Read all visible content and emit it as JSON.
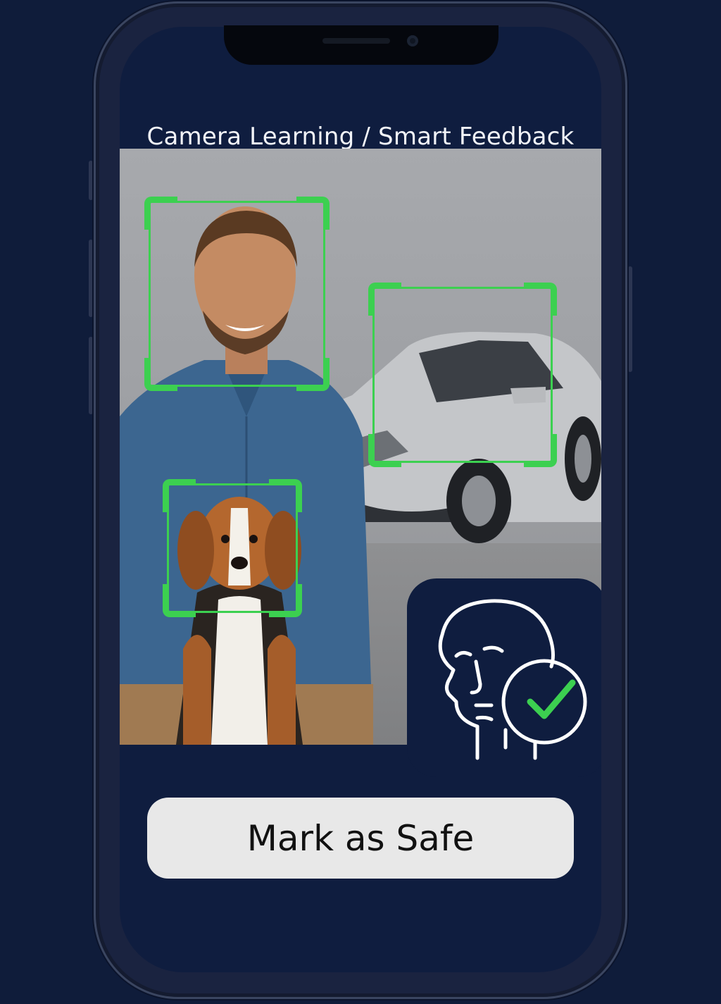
{
  "header": {
    "title": "Camera Learning / Smart Feedback"
  },
  "detections": [
    {
      "object": "person-face"
    },
    {
      "object": "car"
    },
    {
      "object": "dog"
    }
  ],
  "badge": {
    "icon": "face-recognition-check-icon"
  },
  "actions": {
    "mark_safe_label": "Mark as Safe"
  },
  "colors": {
    "background": "#0f1c3a",
    "screen": "#0f1d3f",
    "bounding_box": "#3cd050",
    "button_bg": "#e8e8e8",
    "button_text": "#111111",
    "check": "#3cd050"
  }
}
